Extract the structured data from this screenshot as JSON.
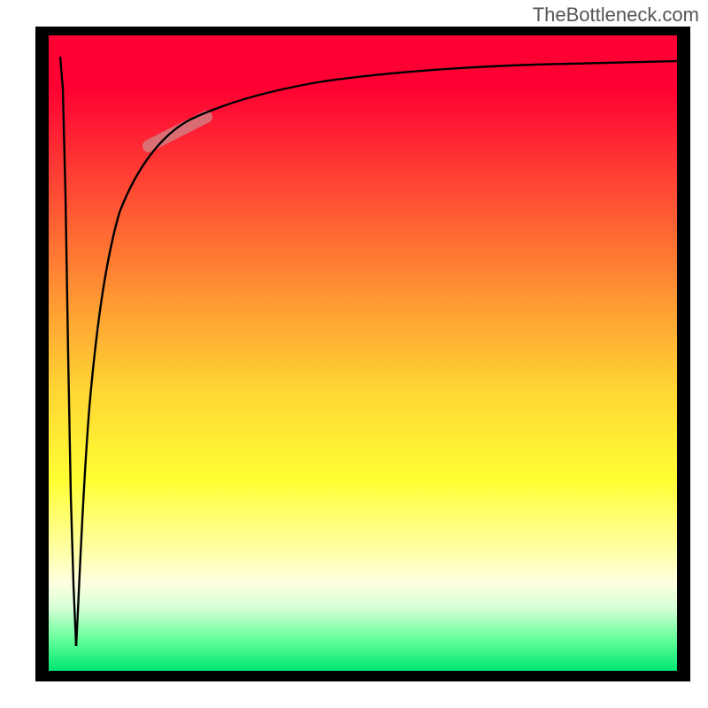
{
  "attribution": "TheBottleneck.com",
  "chart_data": {
    "type": "line",
    "title": "",
    "xlabel": "",
    "ylabel": "",
    "xlim": [
      0,
      100
    ],
    "ylim": [
      0,
      100
    ],
    "grid": false,
    "legend": false,
    "background_gradient": [
      "#ff0033",
      "#ff5a33",
      "#ffd633",
      "#ffff33",
      "#ffffe0",
      "#66ff99",
      "#00e673"
    ],
    "series": [
      {
        "name": "curve-left",
        "x": [
          1.5,
          1.8,
          2.2,
          2.6,
          3.0,
          3.4,
          3.8
        ],
        "y": [
          4,
          12,
          30,
          55,
          75,
          88,
          97
        ]
      },
      {
        "name": "curve-right",
        "x": [
          3.8,
          5,
          7,
          9,
          12,
          15,
          18,
          22,
          27,
          33,
          40,
          50,
          60,
          72,
          85,
          100
        ],
        "y": [
          3,
          30,
          55,
          67,
          76,
          81,
          84,
          86.5,
          88.7,
          90.3,
          91.6,
          92.8,
          93.6,
          94.3,
          94.9,
          95.5
        ]
      }
    ],
    "highlight": {
      "name": "smudge",
      "x_range": [
        16,
        24
      ],
      "y_range": [
        82,
        87
      ]
    }
  }
}
